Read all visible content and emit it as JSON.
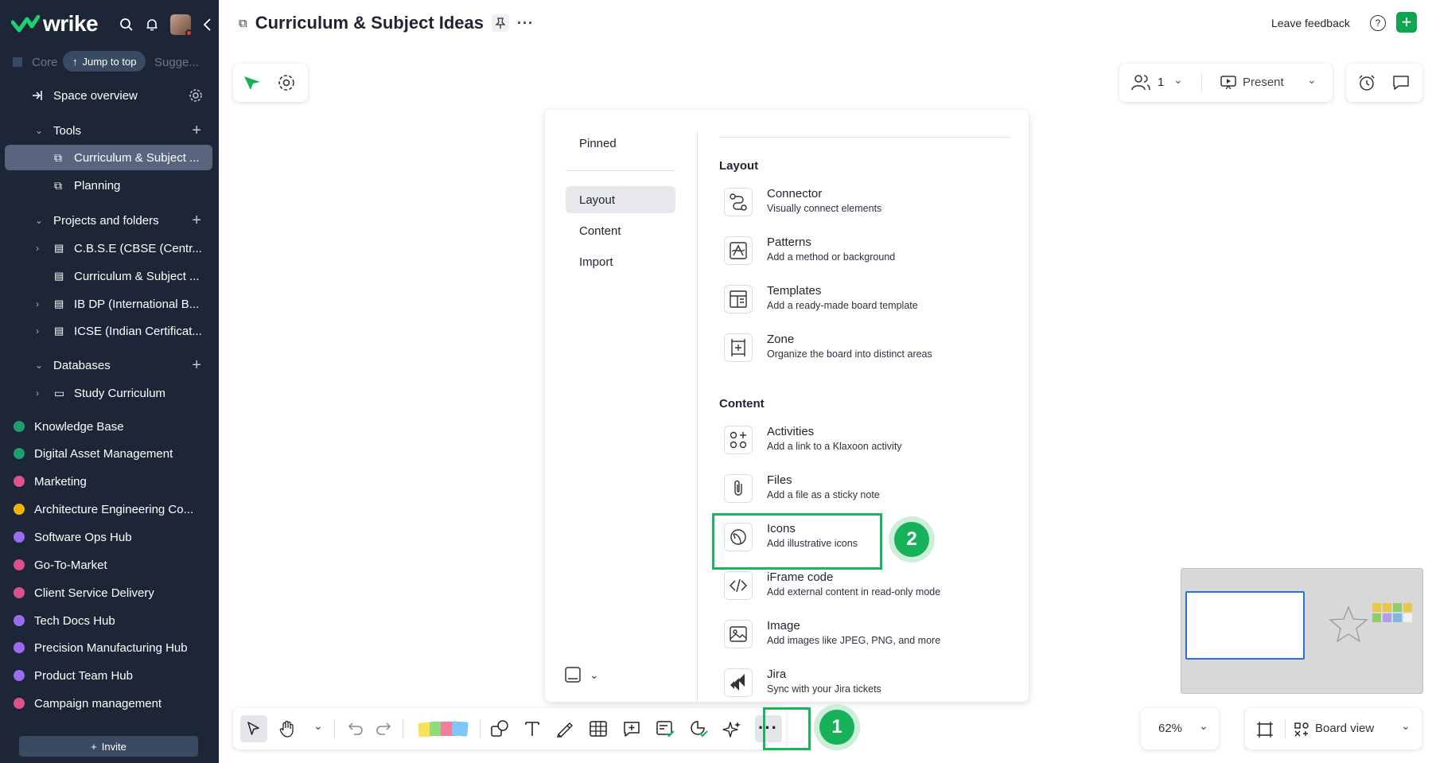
{
  "app": {
    "logo_text": "wrike"
  },
  "sidebar": {
    "crumb_left": "Core",
    "crumb_right": "Sugge...",
    "jump_label": "Jump to top",
    "space_overview": "Space overview",
    "tools_label": "Tools",
    "tools_items": [
      "Curriculum & Subject ...",
      "Planning"
    ],
    "projects_label": "Projects and folders",
    "projects_items": [
      "C.B.S.E (CBSE (Centr...",
      "Curriculum & Subject ...",
      "IB DP (International B...",
      "ICSE (Indian Certificat..."
    ],
    "databases_label": "Databases",
    "databases_items": [
      "Study Curriculum"
    ],
    "spaces": [
      {
        "label": "Knowledge Base",
        "color": "#1e9e6b"
      },
      {
        "label": "Digital Asset Management",
        "color": "#1e9e6b"
      },
      {
        "label": "Marketing",
        "color": "#e0508a"
      },
      {
        "label": "Architecture Engineering Co...",
        "color": "#f0b400"
      },
      {
        "label": "Software Ops Hub",
        "color": "#9a6cf0"
      },
      {
        "label": "Go-To-Market",
        "color": "#d9508a"
      },
      {
        "label": "Client Service Delivery",
        "color": "#d9508a"
      },
      {
        "label": "Tech Docs Hub",
        "color": "#9a6cf0"
      },
      {
        "label": "Precision Manufacturing Hub",
        "color": "#9a6cf0"
      },
      {
        "label": "Product Team Hub",
        "color": "#9a6cf0"
      },
      {
        "label": "Campaign management",
        "color": "#e0508a"
      }
    ],
    "invite_label": "Invite"
  },
  "header": {
    "title": "Curriculum & Subject Ideas",
    "leave_feedback": "Leave feedback",
    "help": "?",
    "add": "+"
  },
  "board": {
    "people_count": "1",
    "present_label": "Present",
    "zoom": "62%",
    "view_label": "Board view"
  },
  "panel": {
    "tabs": [
      "Pinned",
      "Layout",
      "Content",
      "Import"
    ],
    "selected_tab": "Layout",
    "sections": [
      {
        "title": "Layout",
        "items": [
          {
            "title": "Connector",
            "desc": "Visually connect elements",
            "icon": "connector-icon"
          },
          {
            "title": "Patterns",
            "desc": "Add a method or background",
            "icon": "patterns-icon"
          },
          {
            "title": "Templates",
            "desc": "Add a ready-made board template",
            "icon": "templates-icon"
          },
          {
            "title": "Zone",
            "desc": "Organize the board into distinct areas",
            "icon": "zone-icon"
          }
        ]
      },
      {
        "title": "Content",
        "items": [
          {
            "title": "Activities",
            "desc": "Add a link to a Klaxoon activity",
            "icon": "activities-icon"
          },
          {
            "title": "Files",
            "desc": "Add a file as a sticky note",
            "icon": "paperclip-icon"
          },
          {
            "title": "Icons",
            "desc": "Add illustrative icons",
            "icon": "icons-icon"
          },
          {
            "title": "iFrame code",
            "desc": "Add external content in read-only mode",
            "icon": "code-icon"
          },
          {
            "title": "Image",
            "desc": "Add images like JPEG, PNG, and more",
            "icon": "image-icon"
          },
          {
            "title": "Jira",
            "desc": "Sync with your Jira tickets",
            "icon": "jira-icon"
          }
        ]
      }
    ]
  },
  "annotations": {
    "step1": "1",
    "step2": "2",
    "accent": "#1bb35c"
  }
}
